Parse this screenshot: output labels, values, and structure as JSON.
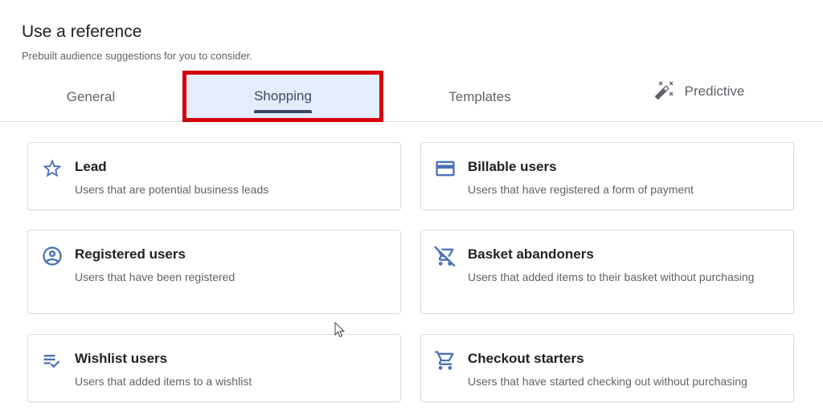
{
  "header": {
    "title": "Use a reference",
    "subtitle": "Prebuilt audience suggestions for you to consider."
  },
  "tabs": [
    {
      "label": "General",
      "selected": false
    },
    {
      "label": "Shopping",
      "selected": true
    },
    {
      "label": "Templates",
      "selected": false
    },
    {
      "label": "Predictive",
      "selected": false,
      "icon": "magic-wand-icon"
    }
  ],
  "cards": [
    {
      "title": "Lead",
      "description": "Users that are potential business leads",
      "icon": "star-icon"
    },
    {
      "title": "Billable users",
      "description": "Users that have registered a form of payment",
      "icon": "credit-card-icon"
    },
    {
      "title": "Registered users",
      "description": "Users that have been registered",
      "icon": "account-circle-icon"
    },
    {
      "title": "Basket abandoners",
      "description": "Users that added items to their basket without purchasing",
      "icon": "remove-shopping-cart-icon"
    },
    {
      "title": "Wishlist users",
      "description": "Users that added items to a wishlist",
      "icon": "playlist-check-icon"
    },
    {
      "title": "Checkout starters",
      "description": "Users that have started checking out without purchasing",
      "icon": "shopping-cart-icon"
    }
  ],
  "colors": {
    "accent_blue": "#4a72b8",
    "highlight_border": "#d4000b",
    "selected_tab_bg": "#e3edfb"
  }
}
